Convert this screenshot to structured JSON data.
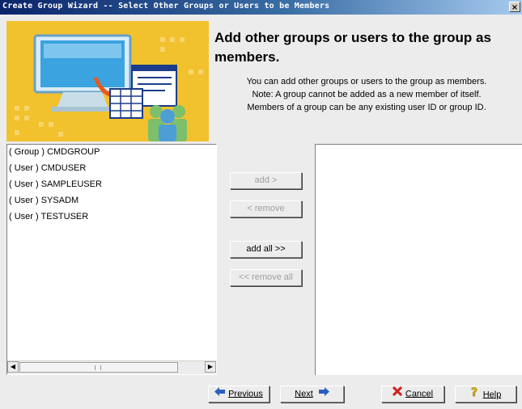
{
  "window": {
    "title": "Create Group Wizard -- Select Other Groups or Users to be Members",
    "close_label": "×"
  },
  "header": {
    "heading": "Add other groups or users to the group as members.",
    "desc_lines": [
      "You can add other groups or users to the group as members.",
      "Note: A group cannot be added as a new member of itself.",
      "Members of a group can be any existing user ID or group ID."
    ]
  },
  "available": {
    "items": [
      "( Group ) CMDGROUP",
      "( User ) CMDUSER",
      "( User ) SAMPLEUSER",
      "( User ) SYSADM",
      "( User ) TESTUSER"
    ]
  },
  "members": {
    "items": []
  },
  "transfer": {
    "add": "add >",
    "remove": "< remove",
    "add_all": "add all >>",
    "remove_all": "<< remove all"
  },
  "footer": {
    "previous": "Previous",
    "next": "Next",
    "cancel": "Cancel",
    "help": "Help"
  },
  "colors": {
    "titlebar": "#0a246a",
    "banner": "#f2c12e",
    "disabled_text": "#a0a0a0"
  }
}
